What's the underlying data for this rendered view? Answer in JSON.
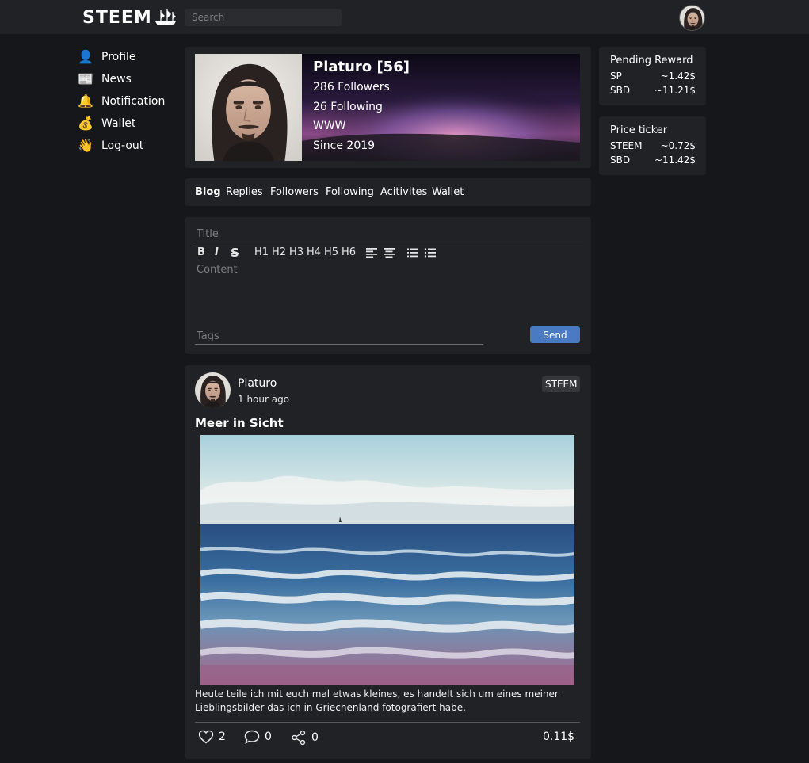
{
  "header": {
    "logo_text": "STEEM",
    "search_placeholder": "Search"
  },
  "sidebar": {
    "items": [
      {
        "label": "Profile",
        "icon": "👤"
      },
      {
        "label": "News",
        "icon": "📰"
      },
      {
        "label": "Notification",
        "icon": "🔔"
      },
      {
        "label": "Wallet",
        "icon": "💰"
      },
      {
        "label": "Log-out",
        "icon": "👋"
      }
    ]
  },
  "profile": {
    "name": "Platuro [56]",
    "followers": "286 Followers",
    "following": "26 Following",
    "website": "WWW",
    "since": "Since 2019"
  },
  "tabs": [
    "Blog",
    "Replies",
    "Followers",
    "Following",
    "Acitivites",
    "Wallet"
  ],
  "editor": {
    "title_placeholder": "Title",
    "content_placeholder": "Content",
    "tags_placeholder": "Tags",
    "send_label": "Send",
    "toolbar": [
      "B",
      "I",
      "S",
      "H1",
      "H2",
      "H3",
      "H4",
      "H5",
      "H6"
    ]
  },
  "post": {
    "author": "Platuro",
    "time": "1 hour ago",
    "tag": "STEEM",
    "title": "Meer in Sicht",
    "body": "Heute teile ich mit euch mal etwas kleines, es handelt sich um eines meiner Lieblingsbilder das ich in Griechenland fotografiert habe.",
    "likes": "2",
    "comments": "0",
    "shares": "0",
    "payout": "0.11$"
  },
  "pending_reward": {
    "title": "Pending Reward",
    "rows": [
      {
        "label": "SP",
        "value": "~1.42$"
      },
      {
        "label": "SBD",
        "value": "~11.21$"
      }
    ]
  },
  "price_ticker": {
    "title": "Price ticker",
    "rows": [
      {
        "label": "STEEM",
        "value": "~0.72$"
      },
      {
        "label": "SBD",
        "value": "~11.42$"
      }
    ]
  },
  "colors": {
    "background": "#16171a",
    "card": "#202226",
    "accent": "#4a7ac2"
  }
}
